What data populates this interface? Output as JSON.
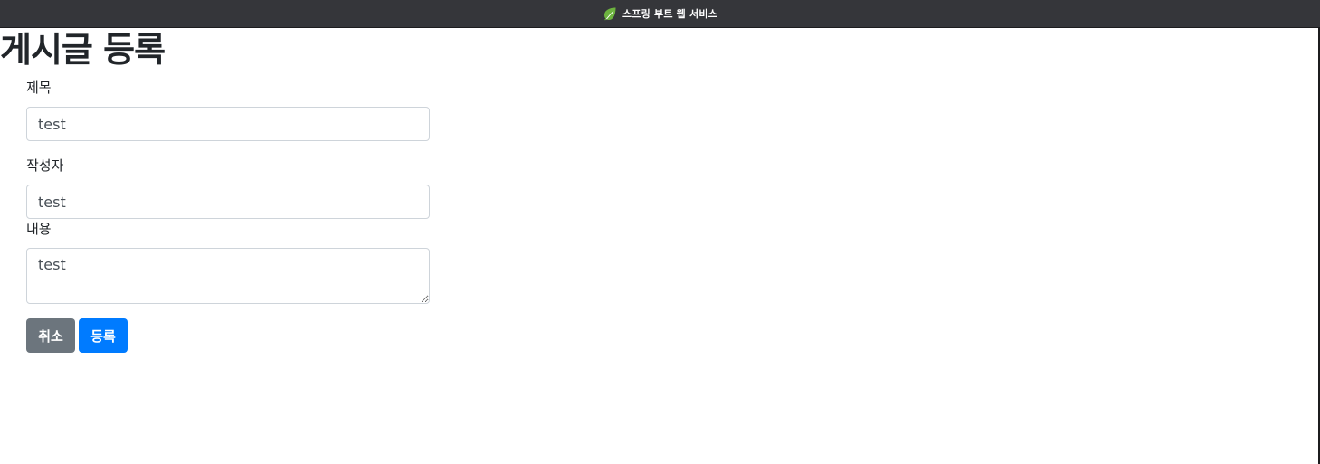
{
  "window": {
    "title": "스프링 부트 웹 서비스",
    "title_icon": "spring-leaf-icon"
  },
  "page": {
    "heading": "게시글 등록"
  },
  "form": {
    "title_label": "제목",
    "title_value": "test",
    "author_label": "작성자",
    "author_value": "test",
    "content_label": "내용",
    "content_value": "test"
  },
  "buttons": {
    "cancel_label": "취소",
    "submit_label": "등록"
  },
  "colors": {
    "titlebar": "#35363a",
    "primary": "#007bff",
    "secondary": "#6c757d",
    "leaf": "#6db33f"
  }
}
